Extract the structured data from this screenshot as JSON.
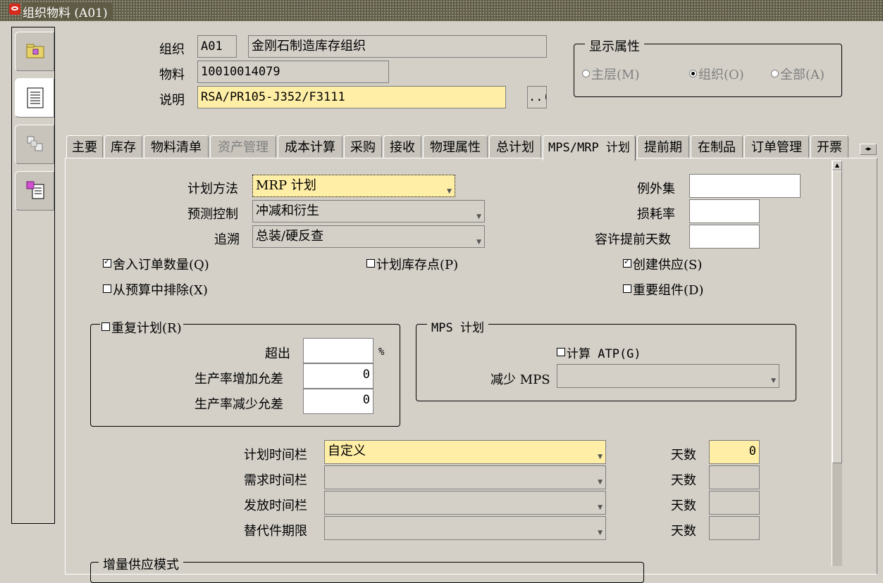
{
  "window": {
    "title": "组织物料 (A01)"
  },
  "header": {
    "org_label": "组织",
    "org_code": "A01",
    "org_name": "金刚石制造库存组织",
    "item_label": "物料",
    "item_value": "10010014079",
    "desc_label": "说明",
    "desc_value": "RSA/PR105-J352/F3111",
    "more_button": "..("
  },
  "display_attrs": {
    "title": "显示属性",
    "options": [
      {
        "label": "主层(M)",
        "selected": false
      },
      {
        "label": "组织(O)",
        "selected": true
      },
      {
        "label": "全部(A)",
        "selected": false
      }
    ]
  },
  "tabs": [
    {
      "label": "主要",
      "disabled": false
    },
    {
      "label": "库存",
      "disabled": false
    },
    {
      "label": "物料清单",
      "disabled": false
    },
    {
      "label": "资产管理",
      "disabled": true
    },
    {
      "label": "成本计算",
      "disabled": false
    },
    {
      "label": "采购",
      "disabled": false
    },
    {
      "label": "接收",
      "disabled": false
    },
    {
      "label": "物理属性",
      "disabled": false
    },
    {
      "label": "总计划",
      "disabled": false
    },
    {
      "label": "MPS/MRP 计划",
      "disabled": false,
      "active": true
    },
    {
      "label": "提前期",
      "disabled": false
    },
    {
      "label": "在制品",
      "disabled": false
    },
    {
      "label": "订单管理",
      "disabled": false
    },
    {
      "label": "开票",
      "disabled": false
    }
  ],
  "form": {
    "plan_method_label": "计划方法",
    "plan_method_value": "MRP 计划",
    "forecast_label": "预测控制",
    "forecast_value": "冲减和衍生",
    "pegging_label": "追溯",
    "pegging_value": "总装/硬反查",
    "exception_label": "例外集",
    "exception_value": "",
    "shrink_label": "损耗率",
    "shrink_value": "",
    "tolerance_label": "容许提前天数",
    "tolerance_value": "",
    "checkboxes": {
      "round_qty": {
        "label": "舍入订单数量(Q)",
        "checked": true
      },
      "plan_stock": {
        "label": "计划库存点(P)",
        "checked": false
      },
      "create_supply": {
        "label": "创建供应(S)",
        "checked": true
      },
      "exclude_budget": {
        "label": "从预算中排除(X)",
        "checked": false
      },
      "critical": {
        "label": "重要组件(D)",
        "checked": false
      }
    },
    "repetitive": {
      "label": "重复计划(R)",
      "checked": false,
      "overrun_label": "超出",
      "overrun_value": "",
      "overrun_unit": "%",
      "rate_inc_label": "生产率增加允差",
      "rate_inc_value": "0",
      "rate_dec_label": "生产率减少允差",
      "rate_dec_value": "0"
    },
    "mps": {
      "title": "MPS 计划",
      "calc_atp_label": "计算 ATP(G)",
      "calc_atp_checked": false,
      "reduce_label": "减少 MPS",
      "reduce_value": ""
    },
    "fences": [
      {
        "label": "计划时间栏",
        "value": "自定义",
        "days_label": "天数",
        "days_value": "0",
        "active": true
      },
      {
        "label": "需求时间栏",
        "value": "",
        "days_label": "天数",
        "days_value": "",
        "active": false
      },
      {
        "label": "发放时间栏",
        "value": "",
        "days_label": "天数",
        "days_value": "",
        "active": false
      },
      {
        "label": "替代件期限",
        "value": "",
        "days_label": "天数",
        "days_value": "",
        "active": false
      }
    ],
    "incremental_label": "增量供应模式"
  }
}
